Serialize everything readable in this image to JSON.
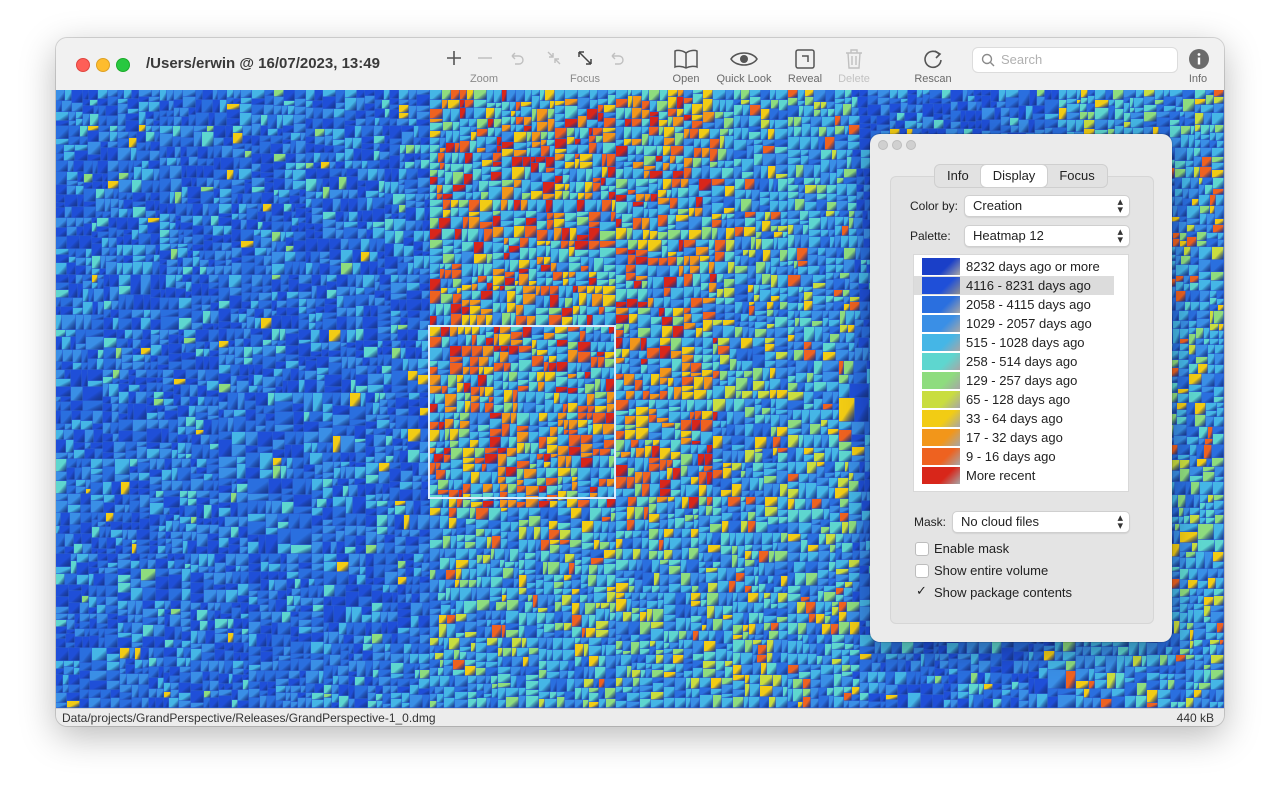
{
  "window": {
    "title": "/Users/erwin @ 16/07/2023, 13:49"
  },
  "toolbar": {
    "zoom_label": "Zoom",
    "focus_label": "Focus",
    "open_label": "Open",
    "quicklook_label": "Quick Look",
    "reveal_label": "Reveal",
    "delete_label": "Delete",
    "rescan_label": "Rescan",
    "info_label": "Info",
    "search_placeholder": "Search"
  },
  "panel": {
    "tabs": [
      "Info",
      "Display",
      "Focus"
    ],
    "selected_tab": "Display",
    "color_by_label": "Color by:",
    "color_by_value": "Creation",
    "palette_label": "Palette:",
    "palette_value": "Heatmap 12",
    "legend": [
      {
        "label": "8232 days ago or more",
        "color": "#1a3fc8"
      },
      {
        "label": "4116 - 8231 days ago",
        "color": "#1f4fd8",
        "selected": true
      },
      {
        "label": "2058 - 4115 days ago",
        "color": "#2a6fdf"
      },
      {
        "label": "1029 - 2057 days ago",
        "color": "#3a8fe6"
      },
      {
        "label": "515 - 1028 days ago",
        "color": "#45b6e6"
      },
      {
        "label": "258 - 514 days ago",
        "color": "#5ed6cf"
      },
      {
        "label": "129 - 257 days ago",
        "color": "#8edc7e"
      },
      {
        "label": "65 - 128 days ago",
        "color": "#c9dd3f"
      },
      {
        "label": "33 - 64 days ago",
        "color": "#f2cc14"
      },
      {
        "label": "17 - 32 days ago",
        "color": "#f2961a"
      },
      {
        "label": "9 - 16 days ago",
        "color": "#ee6220"
      },
      {
        "label": "More recent",
        "color": "#d8261a"
      }
    ],
    "mask_label": "Mask:",
    "mask_value": "No cloud files",
    "enable_mask_label": "Enable mask",
    "enable_mask_checked": false,
    "show_entire_volume_label": "Show entire volume",
    "show_entire_volume_checked": false,
    "show_package_contents_label": "Show package contents",
    "show_package_contents_checked": true
  },
  "status": {
    "path": "Data/projects/GrandPerspective/Releases/GrandPerspective-1_0.dmg",
    "size": "440 kB"
  }
}
